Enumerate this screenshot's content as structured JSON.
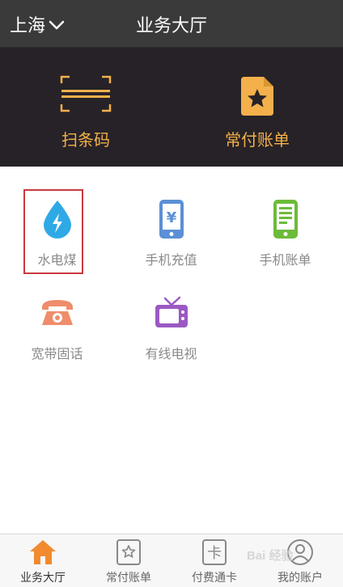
{
  "header": {
    "city": "上海",
    "title": "业务大厅"
  },
  "hero": {
    "scan_label": "扫条码",
    "bills_label": "常付账单"
  },
  "services": [
    {
      "label": "水电煤",
      "icon": "water-drop-lightning-icon"
    },
    {
      "label": "手机充值",
      "icon": "phone-yen-icon"
    },
    {
      "label": "手机账单",
      "icon": "phone-document-icon"
    },
    {
      "label": "宽带固话",
      "icon": "telephone-icon"
    },
    {
      "label": "有线电视",
      "icon": "tv-icon"
    }
  ],
  "tabbar": [
    {
      "label": "业务大厅",
      "icon": "home-icon",
      "active": true
    },
    {
      "label": "常付账单",
      "icon": "star-document-icon"
    },
    {
      "label": "付费通卡",
      "icon": "card-icon"
    },
    {
      "label": "我的账户",
      "icon": "user-icon"
    }
  ],
  "watermark": "Bai 经验",
  "colors": {
    "accent": "#f4b04a",
    "header_bg": "#3a3a3a",
    "hero_bg": "#262227",
    "highlight": "#c9393f",
    "water": "#2fa9e6",
    "phone_blue": "#5b8fd6",
    "phone_green": "#6dbb3a",
    "telephone": "#ef8d6a",
    "tv": "#9b59c3",
    "home": "#f28a2e"
  }
}
